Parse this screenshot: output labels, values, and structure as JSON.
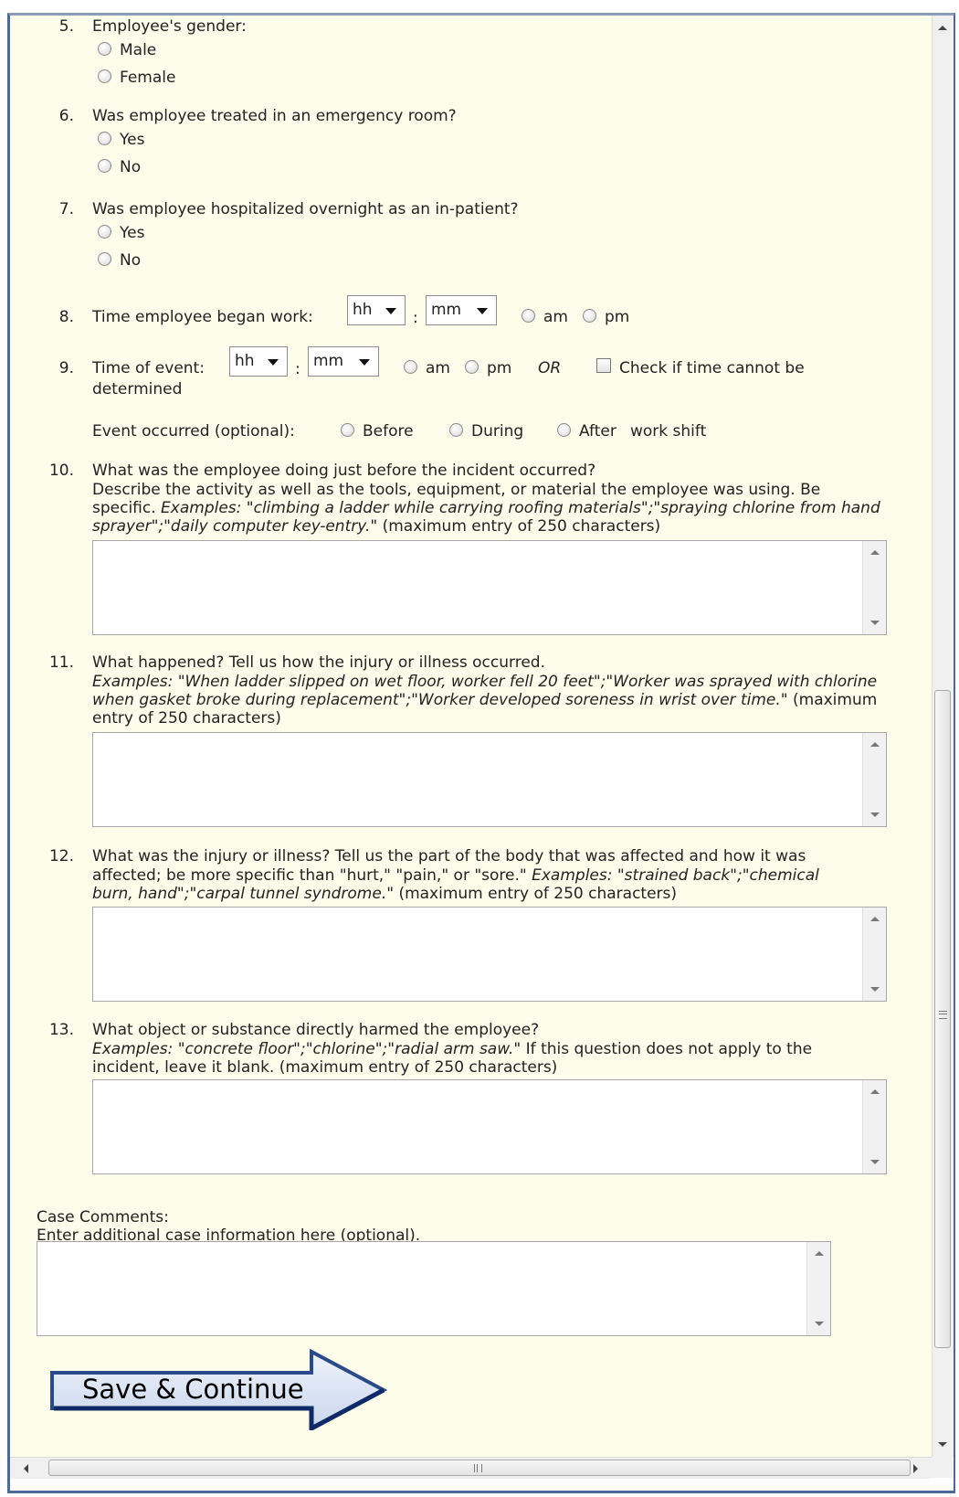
{
  "q5": {
    "num": "5.",
    "text": "Employee's gender:",
    "options": [
      "Male",
      "Female"
    ]
  },
  "q6": {
    "num": "6.",
    "text": "Was employee treated in an emergency room?",
    "options": [
      "Yes",
      "No"
    ]
  },
  "q7": {
    "num": "7.",
    "text": "Was employee hospitalized overnight as an in-patient?",
    "options": [
      "Yes",
      "No"
    ]
  },
  "q8": {
    "num": "8.",
    "text": "Time employee began work:",
    "hour": "hh",
    "minute": "mm",
    "colon": ":",
    "am": "am",
    "pm": "pm"
  },
  "q9": {
    "num": "9.",
    "text": "Time of event:",
    "hour": "hh",
    "minute": "mm",
    "colon": ":",
    "am": "am",
    "pm": "pm",
    "or": "OR",
    "cannot_determine": "Check if time cannot be",
    "cannot_determine_2": "determined",
    "occurred_label": "Event occurred (optional):",
    "before": "Before",
    "during": "During",
    "after": "After",
    "work_shift": "work shift"
  },
  "q10": {
    "num": "10.",
    "text": "What was the employee doing just before the incident occurred?",
    "line1": "Describe the activity as well as the tools, equipment, or material the employee was using. Be",
    "line2_plain": "specific. ",
    "line2_italic": "Examples: \"climbing a ladder while carrying roofing materials\";\"spraying chlorine from hand",
    "line3_italic": "sprayer\";\"daily computer key-entry.\"",
    "line3_plain": " (maximum entry of 250 characters)",
    "value": ""
  },
  "q11": {
    "num": "11.",
    "text": "What happened? Tell us how the injury or illness occurred.",
    "line1_italic": "Examples: \"When ladder slipped on wet floor, worker fell 20 feet\";\"Worker was sprayed with chlorine",
    "line2_italic": "when gasket broke during replacement\";\"Worker developed soreness in wrist over time.\"",
    "line2_plain": " (maximum",
    "line3_plain": "entry of 250 characters)",
    "value": ""
  },
  "q12": {
    "num": "12.",
    "text": "What was the injury or illness? Tell us the part of the body that was affected and how it was",
    "line1_plain": "affected; be more specific than \"hurt,\" \"pain,\" or \"sore.\" ",
    "line1_italic": "Examples: \"strained back\";\"chemical",
    "line2_italic": "burn, hand\";\"carpal tunnel syndrome.\"",
    "line2_plain": " (maximum entry of 250 characters)",
    "value": ""
  },
  "q13": {
    "num": "13.",
    "text": "What object or substance directly harmed the employee?",
    "line1_italic": "Examples: \"concrete floor\";\"chlorine\";\"radial arm saw.\"",
    "line1_plain": " If this question does not apply to the",
    "line2_plain": "incident, leave it blank. (maximum entry of 250 characters)",
    "value": ""
  },
  "comments": {
    "title": "Case Comments:",
    "subtitle": "Enter additional case information here (optional).",
    "value": ""
  },
  "save_button": "Save & Continue",
  "colors": {
    "background": "#fdfdec",
    "frame": "#4a6b9a",
    "arrow_fill": "#dde6f5",
    "arrow_stroke": "#2b4a8a"
  }
}
